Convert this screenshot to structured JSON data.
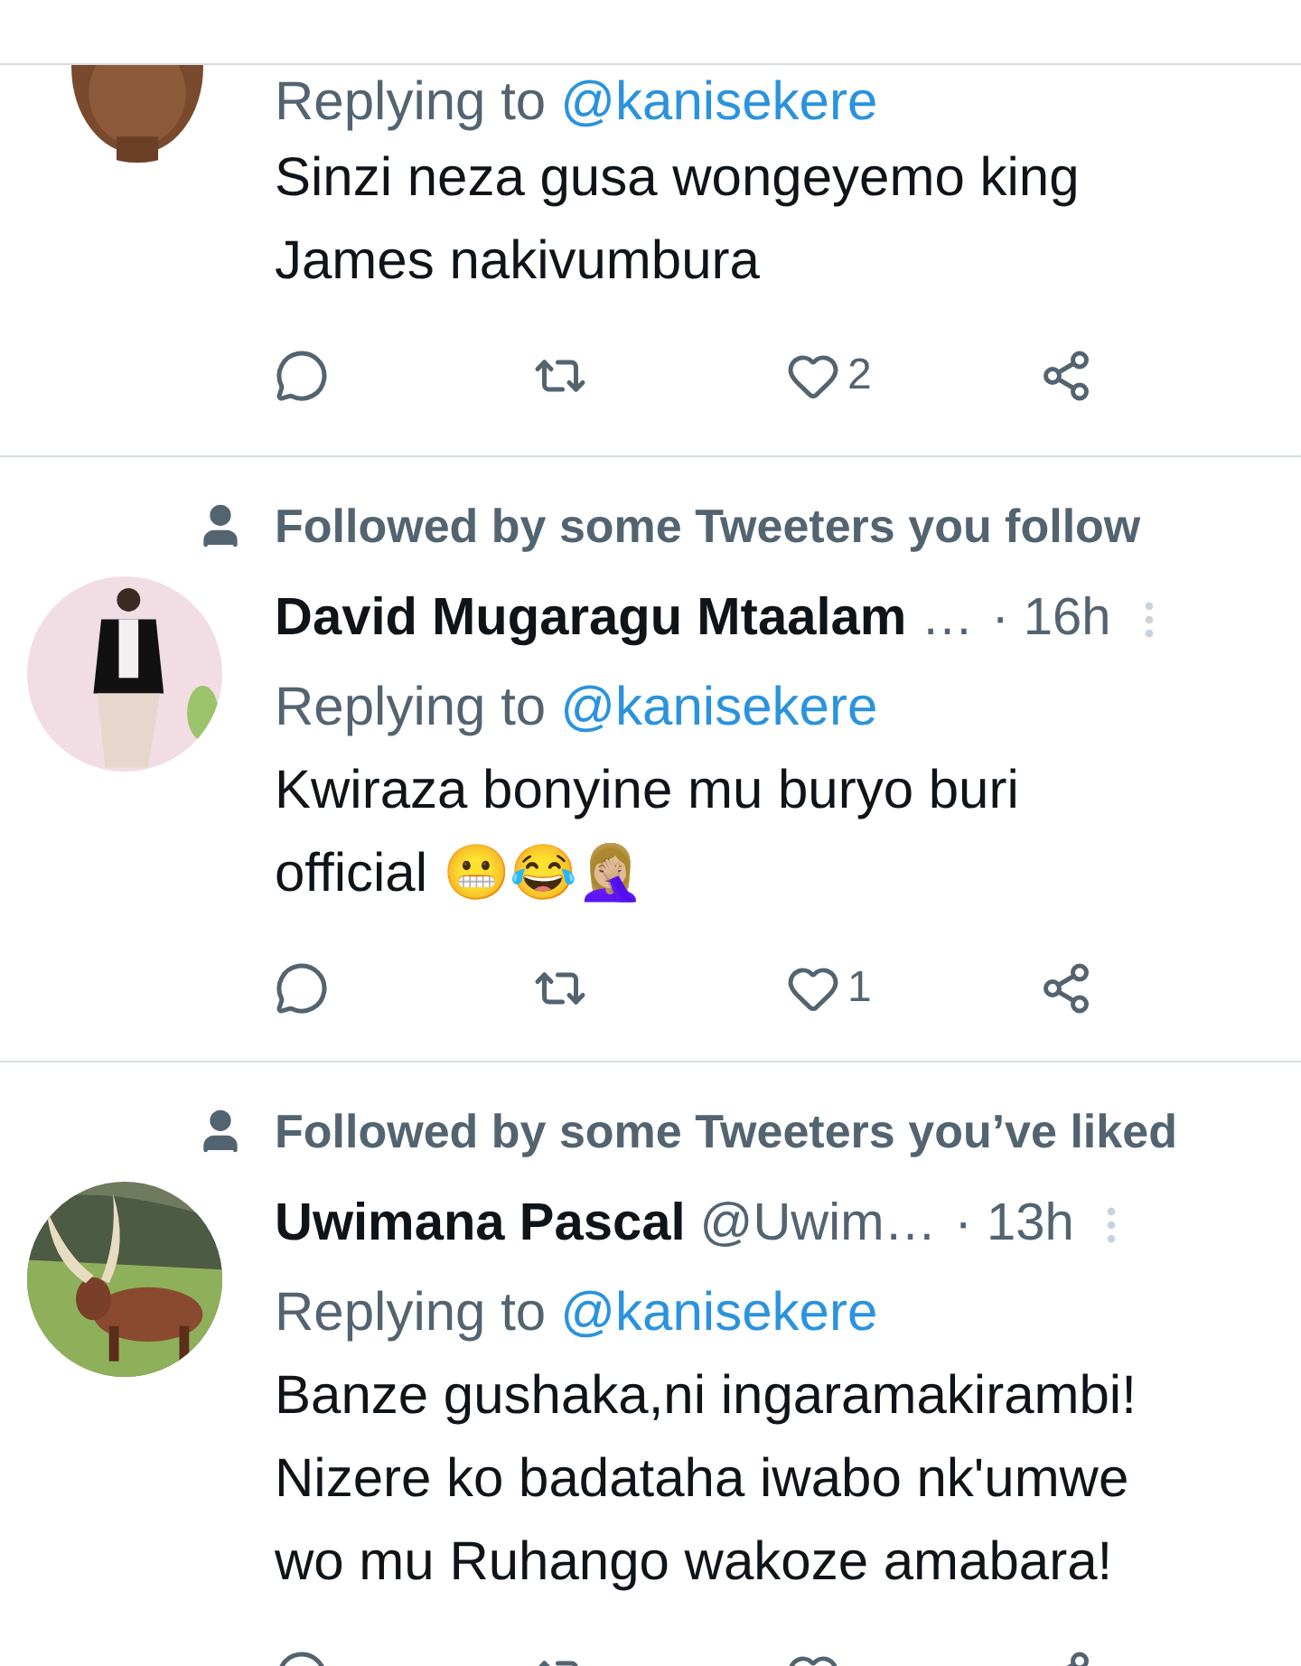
{
  "tweets": [
    {
      "replying_to": {
        "label": "Replying to",
        "handle": "@kanisekere"
      },
      "text": "Sinzi neza gusa wongeyemo king James nakivumbura",
      "actions": {
        "like_count": "2"
      }
    },
    {
      "social_context": "Followed by some Tweeters you follow",
      "name": "David Mugaragu Mtaalam",
      "handle": "…",
      "time": "· 16h",
      "replying_to": {
        "label": "Replying to",
        "handle": "@kanisekere"
      },
      "text": "Kwiraza bonyine mu buryo buri official 😬😂🤦🏼‍♀️",
      "actions": {
        "like_count": "1"
      }
    },
    {
      "social_context": "Followed by some Tweeters you’ve liked",
      "name": "Uwimana Pascal",
      "handle": "@Uwim…",
      "time": "· 13h",
      "replying_to": {
        "label": "Replying to",
        "handle": "@kanisekere"
      },
      "text": "Banze gushaka,ni ingaramakirambi! Nizere ko badataha iwabo nk'umwe wo mu Ruhango wakoze amabara!"
    }
  ]
}
